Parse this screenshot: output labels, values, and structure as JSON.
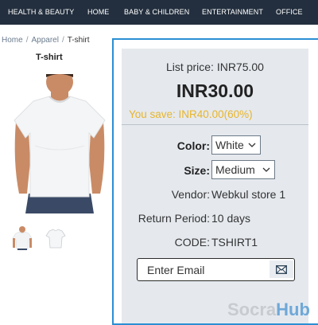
{
  "nav": {
    "items": [
      {
        "label": "HEALTH & BEAUTY"
      },
      {
        "label": "HOME"
      },
      {
        "label": "BABY & CHILDREN"
      },
      {
        "label": "ENTERTAINMENT"
      },
      {
        "label": "OFFICE"
      }
    ],
    "bg_color": "#232f3e"
  },
  "breadcrumb": {
    "items": [
      "Home",
      "Apparel"
    ],
    "current": "T-shirt",
    "separator": "/"
  },
  "product": {
    "title": "T-shirt",
    "main_image": "white-tshirt-model",
    "thumbnails": [
      "tshirt-model-thumb",
      "tshirt-flat-thumb"
    ]
  },
  "pricing": {
    "list_price": "List price: INR75.00",
    "price": "INR30.00",
    "savings": "You save: INR40.00(60%)",
    "savings_color": "#e8b52a"
  },
  "attributes": {
    "color": {
      "label": "Color:",
      "selected": "White"
    },
    "size": {
      "label": "Size:",
      "selected": "Medium"
    },
    "vendor": {
      "label": "Vendor:",
      "value": "Webkul store 1"
    },
    "return_period": {
      "label": "Return Period:",
      "value": "10 days"
    },
    "code": {
      "label": "CODE:",
      "value": "TSHIRT1"
    }
  },
  "email": {
    "placeholder": "Enter Email",
    "button_icon": "envelope-icon"
  },
  "watermark": {
    "part1": "Socra",
    "part2": "Hub"
  },
  "accent_color": "#2b8fd4"
}
